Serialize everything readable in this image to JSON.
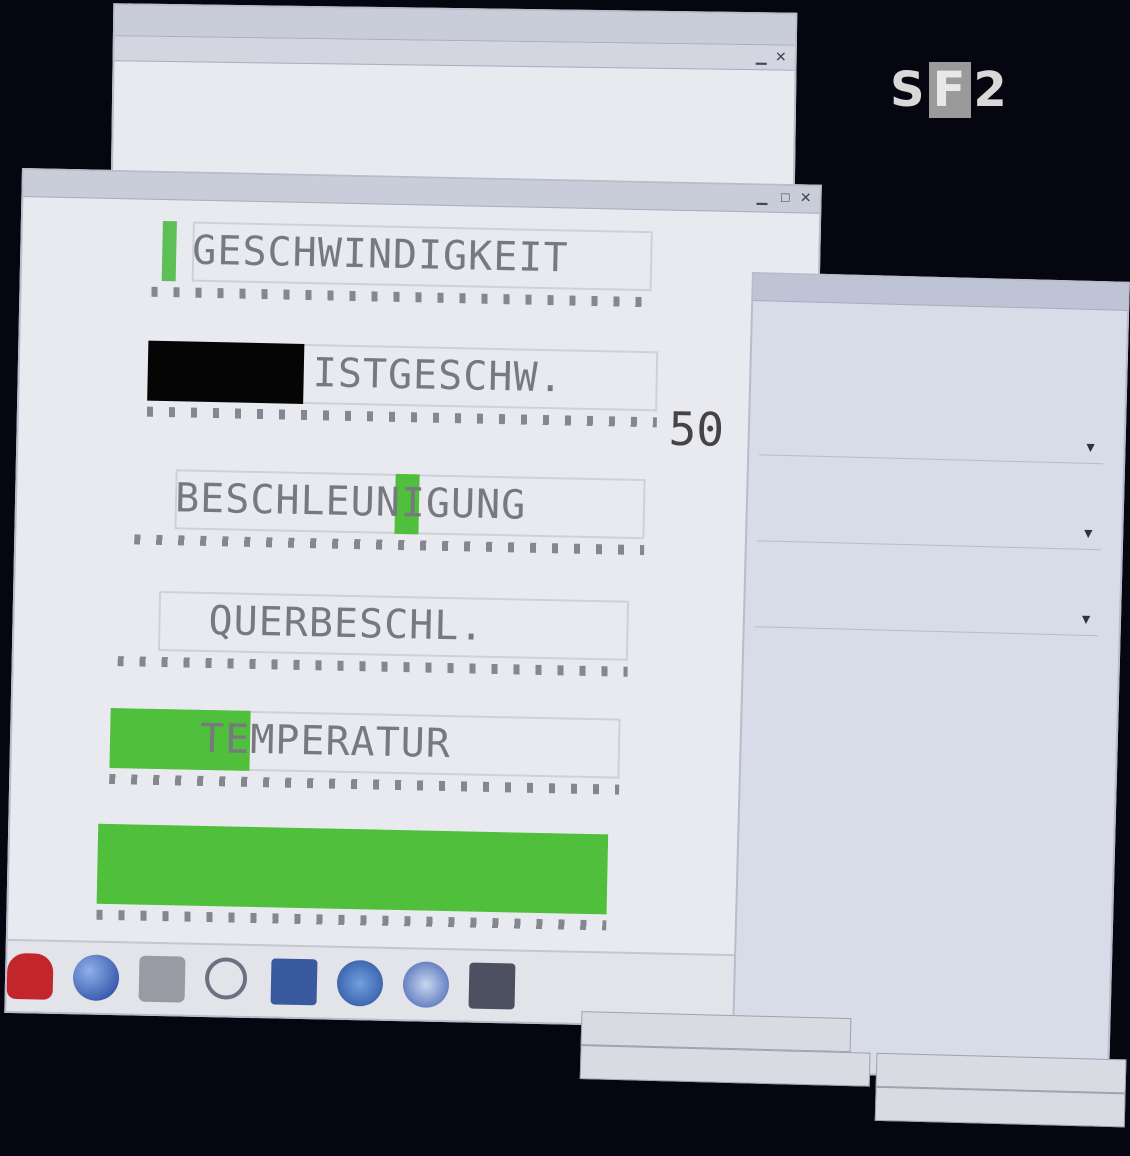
{
  "logo": {
    "s": "S",
    "f": "F",
    "two": "2"
  },
  "colors": {
    "accent_green": "#4fbf3c",
    "dark_fill": "#050505"
  },
  "meters": [
    {
      "label": "GESCHWINDIGKEIT",
      "fill_color": "green-bar",
      "fill_fraction": 0.03
    },
    {
      "label": "ISTGESCHW.",
      "value": "50",
      "fill_color": "black",
      "fill_fraction": 0.27
    },
    {
      "label": "BESCHLEUNIGUNG",
      "fill_color": "green-bar",
      "fill_fraction": 0.04
    },
    {
      "label": "QUERBESCHL.",
      "fill_fraction": 0
    },
    {
      "label": "TEMPERATUR",
      "fill_color": "green",
      "fill_fraction": 0.28
    },
    {
      "label": "",
      "fill_color": "green",
      "fill_fraction": 1.0
    }
  ],
  "taskbar_icons": [
    "redhat-icon",
    "globe-icon",
    "printer-icon",
    "magnifier-icon",
    "monitor-icon",
    "network-icon",
    "mail-icon",
    "terminal-icon"
  ]
}
